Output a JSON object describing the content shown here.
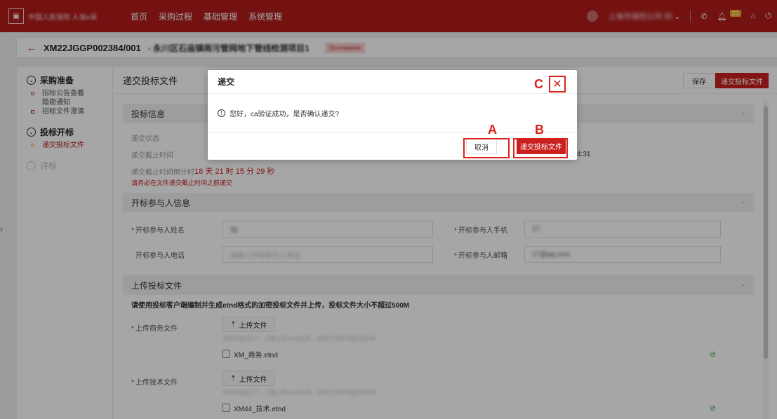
{
  "topbar": {
    "logo_text": "中国人民保险 人保e采",
    "nav": [
      "首页",
      "采购过程",
      "基础管理",
      "系统管理"
    ],
    "company": "上海市保险公司",
    "user": "刘",
    "notification_count": "23"
  },
  "titlebar": {
    "code": "XM22JGGP002384/001",
    "name": "- 永川区石庙镇雨污管网地下管线检测项目1",
    "tag": "已completed"
  },
  "sidebar": {
    "sections": [
      {
        "label": "采购准备",
        "items": [
          "招标公告查看",
          "踏勘通知",
          "招标文件澄清"
        ]
      },
      {
        "label": "投标开标",
        "items": [
          "递交投标文件"
        ]
      },
      {
        "label": "评标",
        "items": []
      }
    ]
  },
  "main": {
    "title": "递交投标文件",
    "save_label": "保存",
    "submit_label": "递交投标文件"
  },
  "bid_info": {
    "heading": "投标信息",
    "status_label": "递交状态",
    "deadline_label": "递交截止时间",
    "countdown_label": "递交截止时间倒计时",
    "countdown_value": "18 天 21 时 15 分 29 秒",
    "deadline_time_tail": "4:31",
    "note": "请务必在文件递交截止时间之前递交"
  },
  "opening": {
    "heading": "开标参与人信息",
    "name_label": "开标参与人姓名",
    "name_value": "刘",
    "mobile_label": "开标参与人手机",
    "mobile_value": "17",
    "phone_label": "开标参与人电话",
    "phone_placeholder": "请输入开标参与人电话",
    "email_label": "开标参与人邮箱",
    "email_value": "17@qq.com"
  },
  "upload": {
    "heading": "上传投标文件",
    "note": "请使用投标客户端编制并生成etnd格式的加密投标文件并上传，投标文件大小不超过500M",
    "business_label": "上传商务文件",
    "technical_label": "上传技术文件",
    "upload_btn": "上传文件",
    "hint": "文件不超过1个，只能上传.etnd文件，且单个文件不超过500M",
    "business_file": "XM_商务.etnd",
    "technical_file": "XM44_技术.etnd"
  },
  "dialog": {
    "title": "递交",
    "message": "您好，ca验证成功，是否确认递交?",
    "cancel_label": "取消",
    "confirm_label": "递交投标文件"
  },
  "annotations": {
    "a": "A",
    "b": "B",
    "c": "C"
  },
  "colors": {
    "brand": "#b21d1d",
    "accent": "#c8201f",
    "annotation": "#d9221c",
    "success": "#3fa73f"
  }
}
